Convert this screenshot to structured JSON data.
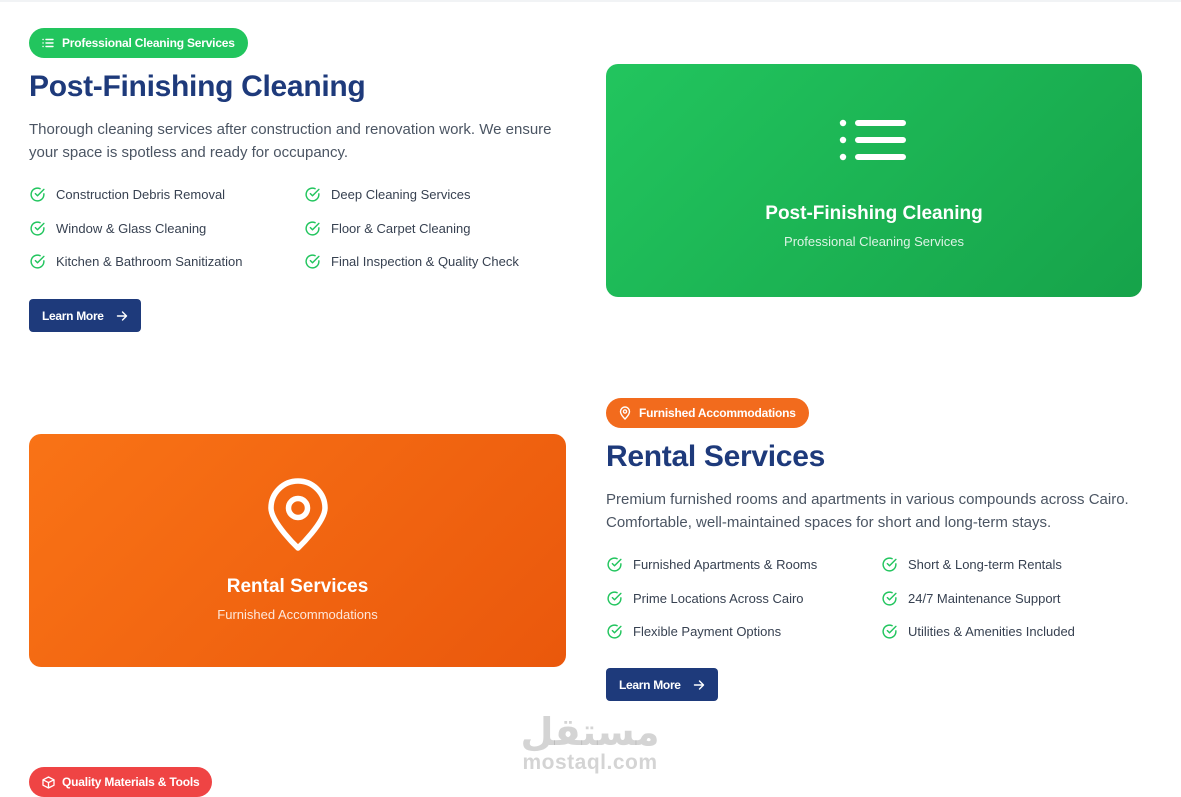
{
  "section1": {
    "badge": "Professional Cleaning Services",
    "title": "Post-Finishing Cleaning",
    "description": "Thorough cleaning services after construction and renovation work. We ensure your space is spotless and ready for occupancy.",
    "features": [
      "Construction Debris Removal",
      "Deep Cleaning Services",
      "Window & Glass Cleaning",
      "Floor & Carpet Cleaning",
      "Kitchen & Bathroom Sanitization",
      "Final Inspection & Quality Check"
    ],
    "button": "Learn More",
    "card": {
      "title": "Post-Finishing Cleaning",
      "subtitle": "Professional Cleaning Services",
      "icon": "list-icon"
    },
    "accent": "#22c55e"
  },
  "section2": {
    "badge": "Furnished Accommodations",
    "title": "Rental Services",
    "description": "Premium furnished rooms and apartments in various compounds across Cairo. Comfortable, well-maintained spaces for short and long-term stays.",
    "features": [
      "Furnished Apartments & Rooms",
      "Short & Long-term Rentals",
      "Prime Locations Across Cairo",
      "24/7 Maintenance Support",
      "Flexible Payment Options",
      "Utilities & Amenities Included"
    ],
    "button": "Learn More",
    "card": {
      "title": "Rental Services",
      "subtitle": "Furnished Accommodations",
      "icon": "map-pin-icon"
    },
    "accent": "#f26b1d"
  },
  "section3": {
    "badge": "Quality Materials & Tools",
    "accent": "#ef4444"
  },
  "watermark": {
    "arabic": "مستقل",
    "latin": "mostaql.com"
  },
  "colors": {
    "primary": "#1e3a7b",
    "check": "#22c55e"
  }
}
